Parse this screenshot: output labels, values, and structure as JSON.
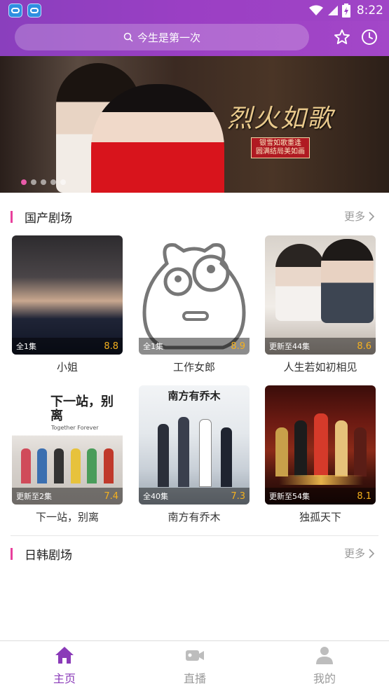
{
  "status_bar": {
    "time": "8:22"
  },
  "search": {
    "placeholder": "今生是第一次"
  },
  "colors": {
    "accent": "#8a3ab8",
    "section_bar": "#e8409c",
    "score": "#f5b11e",
    "header": "#9b3fc4"
  },
  "banner": {
    "title": "烈火如歌",
    "subtitle_line1": "银雪如歌重逢",
    "subtitle_line2": "圆满结局美如画",
    "slides_total": 5,
    "active_slide": 1
  },
  "sections": [
    {
      "title": "国产剧场",
      "more_label": "更多",
      "items": [
        {
          "name": "小姐",
          "episodes": "全1集",
          "score": "8.8"
        },
        {
          "name": "工作女郎",
          "episodes": "全1集",
          "score": "8.9"
        },
        {
          "name": "人生若如初相见",
          "episodes": "更新至44集",
          "score": "8.6"
        },
        {
          "name": "下一站，别离",
          "episodes": "更新至2集",
          "score": "7.4",
          "poster_title": "下一站，别离",
          "poster_subtitle": "Together Forever"
        },
        {
          "name": "南方有乔木",
          "episodes": "全40集",
          "score": "7.3",
          "poster_title": "南方有乔木"
        },
        {
          "name": "独孤天下",
          "episodes": "更新至54集",
          "score": "8.1"
        }
      ]
    },
    {
      "title": "日韩剧场",
      "more_label": "更多",
      "items": []
    }
  ],
  "tabs": [
    {
      "label": "主页",
      "icon": "home-icon",
      "active": true
    },
    {
      "label": "直播",
      "icon": "video-camera-icon",
      "active": false
    },
    {
      "label": "我的",
      "icon": "user-icon",
      "active": false
    }
  ]
}
